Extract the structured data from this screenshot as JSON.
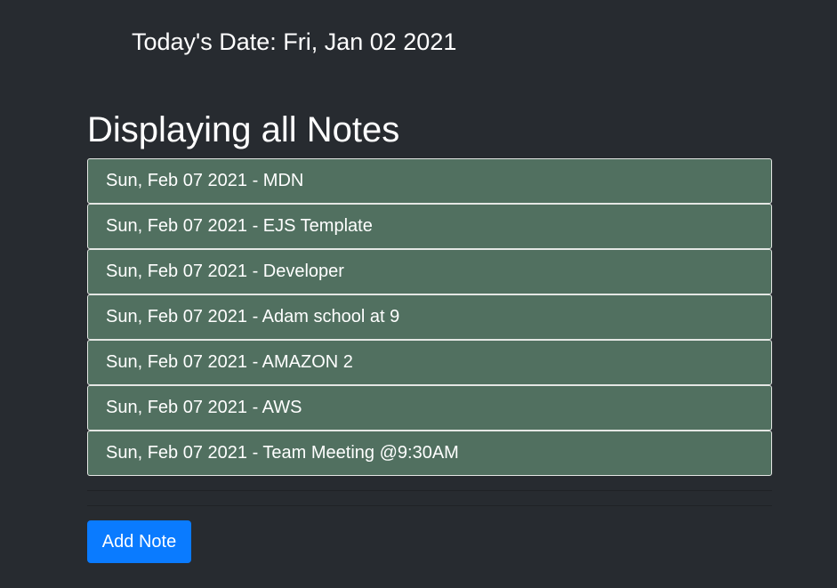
{
  "header": {
    "date_text": "Today's Date: Fri, Jan 02 2021"
  },
  "main": {
    "title": "Displaying all Notes",
    "notes": [
      {
        "label": "Sun, Feb 07 2021 - MDN"
      },
      {
        "label": "Sun, Feb 07 2021 - EJS Template"
      },
      {
        "label": "Sun, Feb 07 2021 - Developer"
      },
      {
        "label": "Sun, Feb 07 2021 - Adam school at 9"
      },
      {
        "label": "Sun, Feb 07 2021 - AMAZON 2"
      },
      {
        "label": "Sun, Feb 07 2021 - AWS"
      },
      {
        "label": "Sun, Feb 07 2021 - Team Meeting @9:30AM"
      }
    ],
    "add_button_label": "Add Note"
  },
  "colors": {
    "background": "#272b30",
    "note_item": "#517060",
    "primary_button": "#0a7bff"
  }
}
